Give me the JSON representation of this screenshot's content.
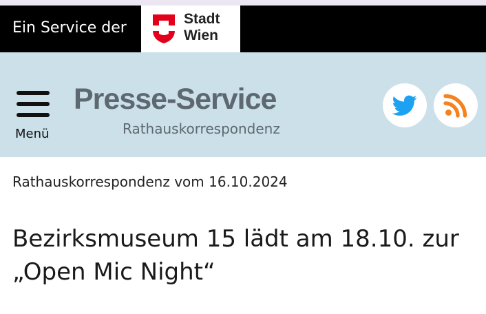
{
  "service_bar": {
    "text": "Ein Service der",
    "logo_line1": "Stadt",
    "logo_line2": "Wien"
  },
  "header": {
    "menu_label": "Menü",
    "title": "Presse-Service",
    "subtitle": "Rathauskorrespondenz",
    "icons": [
      "twitter-icon",
      "rss-icon"
    ]
  },
  "article": {
    "date_line": "Rathauskorrespondenz vom 16.10.2024",
    "headline": "Bezirksmuseum 15 lädt am 18.10. zur „Open Mic Night“"
  },
  "colors": {
    "service_bar_bg": "#000000",
    "header_bg": "#cbe0e9",
    "brand_text": "#5e6870",
    "twitter_blue": "#1da1f2",
    "rss_orange": "#f6821f",
    "wien_red": "#e2001a"
  }
}
